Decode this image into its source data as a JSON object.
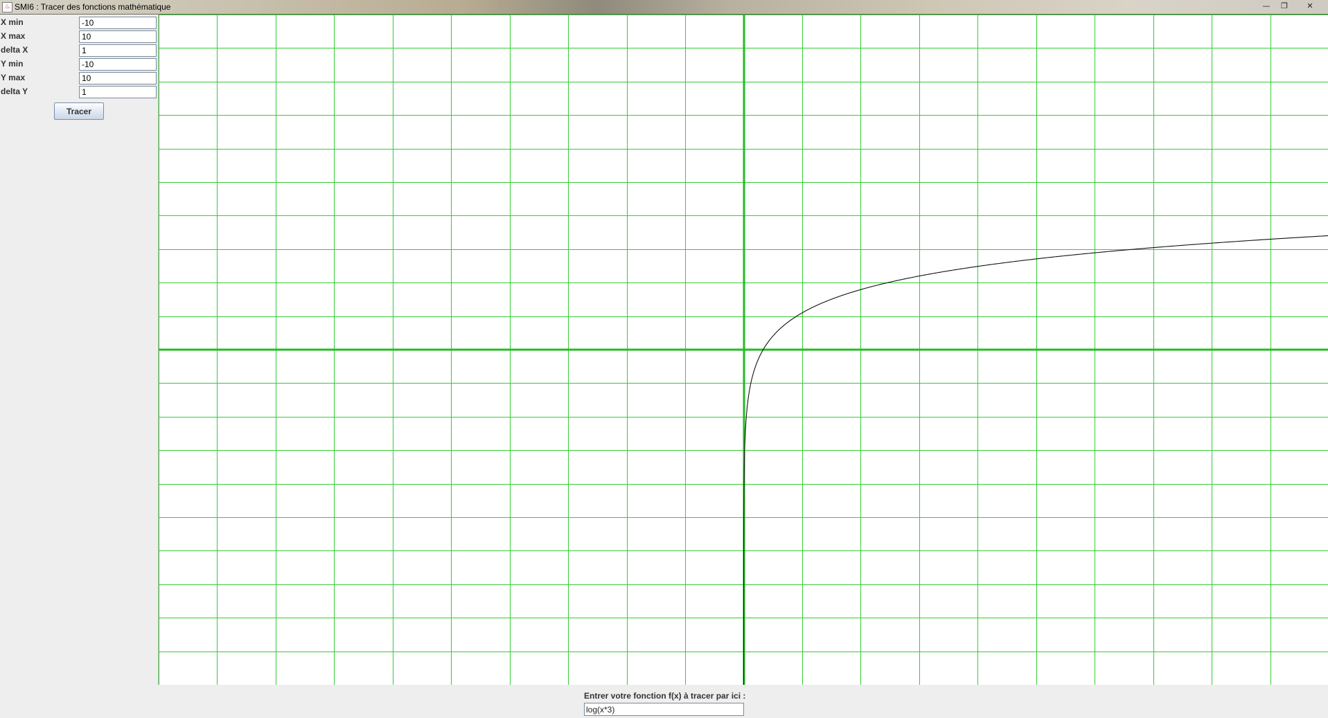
{
  "window": {
    "title": "SMI6 : Tracer des fonctions mathématique",
    "minimize_glyph": "—",
    "maximize_glyph": "❐",
    "close_glyph": "✕",
    "app_icon": "java-app-icon"
  },
  "params": {
    "xmin": {
      "label": "X min",
      "value": "-10"
    },
    "xmax": {
      "label": "X max",
      "value": "10"
    },
    "dx": {
      "label": "delta X",
      "value": "1"
    },
    "ymin": {
      "label": "Y min",
      "value": "-10"
    },
    "ymax": {
      "label": "Y max",
      "value": "10"
    },
    "dy": {
      "label": "delta Y",
      "value": "1"
    },
    "button_label": "Tracer"
  },
  "function_entry": {
    "label": "Entrer votre fonction f(x) à tracer par ici :",
    "value": "log(x*3)"
  },
  "chart_data": {
    "type": "line",
    "function": "log(x*3)",
    "xlim": [
      -10,
      10
    ],
    "ylim": [
      -10,
      10
    ],
    "x_step": 1,
    "y_step": 1,
    "grid": true,
    "colors": {
      "grid": "#33cc33",
      "axes": "#22bb22",
      "curve": "#111111",
      "background": "#ffffff"
    }
  }
}
